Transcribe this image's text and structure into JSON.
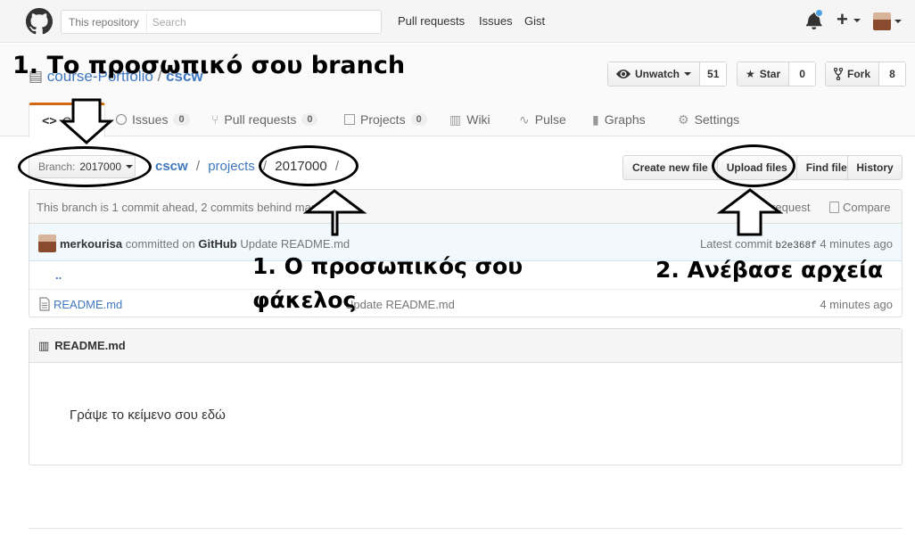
{
  "header": {
    "search_scope": "This repository",
    "search_placeholder": "Search",
    "nav": [
      "Pull requests",
      "Issues",
      "Gist"
    ],
    "icons": [
      "github-logo-icon",
      "bell-icon",
      "plus-icon",
      "avatar"
    ],
    "notification_dot_color": "#4aa3df"
  },
  "repo": {
    "owner": "course-Portfolio",
    "name": "cscw",
    "watch_label": "Unwatch",
    "watch_count": "51",
    "star_label": "Star",
    "star_count": "0",
    "fork_label": "Fork",
    "fork_count": "8",
    "tabs": [
      {
        "label": "Code",
        "count": ""
      },
      {
        "label": "Issues",
        "count": "0"
      },
      {
        "label": "Pull requests",
        "count": "0"
      },
      {
        "label": "Projects",
        "count": "0"
      },
      {
        "label": "Wiki",
        "count": ""
      },
      {
        "label": "Pulse",
        "count": ""
      },
      {
        "label": "Graphs",
        "count": ""
      },
      {
        "label": "Settings",
        "count": ""
      }
    ],
    "selected_tab_color": "#d26911"
  },
  "filenav": {
    "branch_key": "Branch:",
    "branch_value": "2017000",
    "path_root": "cscw",
    "path_dir": "projects",
    "path_current": "2017000",
    "sep": "/",
    "buttons": [
      "Create new file",
      "Upload files",
      "Find file"
    ],
    "history_label": "History"
  },
  "branch_info": {
    "text": "This branch is 1 commit ahead, 2 commits behind master.",
    "pull_request": "Pull request",
    "compare": "Compare"
  },
  "commit": {
    "author": "merkourisa",
    "committed_on": "committed on",
    "platform": "GitHub",
    "message": "Update README.md",
    "latest_label": "Latest commit",
    "sha": "b2e368f",
    "age": "4 minutes ago"
  },
  "files": {
    "up": "..",
    "rows": [
      {
        "name": "README.md",
        "message": "Update README.md",
        "age": "4 minutes ago"
      }
    ]
  },
  "readme": {
    "title": "README.md",
    "content": "Γράψε το κείμενο σου εδώ"
  },
  "annotations": {
    "branch_note": "1. Το προσωπικό σου branch",
    "folder_note_line1": "1. Ο προσωπικός σου",
    "folder_note_line2": "φάκελος",
    "upload_note": "2. Ανέβασε αρχεία"
  }
}
